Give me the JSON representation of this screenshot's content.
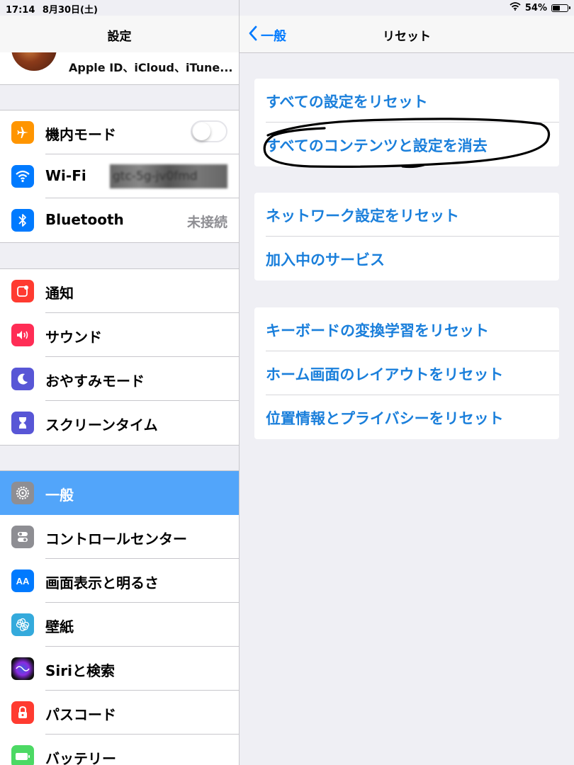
{
  "status_bar": {
    "time": "17:14",
    "date": "8月30日(土)",
    "battery": "54%",
    "battery_level": 0.54
  },
  "sidebar": {
    "title": "設定",
    "apple_id": "Apple ID、iCloud、iTune...",
    "groups": [
      [
        {
          "label": "機内モード",
          "icon": "airplane-icon",
          "color": "#ff9500",
          "toggle": false
        },
        {
          "label": "Wi-Fi",
          "icon": "wifi-icon",
          "color": "#007aff",
          "value": "gtc-5g-jv0fmd"
        },
        {
          "label": "Bluetooth",
          "icon": "bluetooth-icon",
          "color": "#007aff",
          "value": "未接続"
        }
      ],
      [
        {
          "label": "通知",
          "icon": "notifications-icon",
          "color": "#ff3b30"
        },
        {
          "label": "サウンド",
          "icon": "sound-icon",
          "color": "#ff2d55"
        },
        {
          "label": "おやすみモード",
          "icon": "moon-icon",
          "color": "#5856d6"
        },
        {
          "label": "スクリーンタイム",
          "icon": "hourglass-icon",
          "color": "#5856d6"
        }
      ],
      [
        {
          "label": "一般",
          "icon": "gear-icon",
          "color": "#8e8e93",
          "selected": true
        },
        {
          "label": "コントロールセンター",
          "icon": "control-center-icon",
          "color": "#8e8e93"
        },
        {
          "label": "画面表示と明るさ",
          "icon": "display-icon",
          "color": "#007aff"
        },
        {
          "label": "壁紙",
          "icon": "wallpaper-icon",
          "color": "#34aadc"
        },
        {
          "label": "Siriと検索",
          "icon": "siri-icon",
          "color": "#1c1c3a"
        },
        {
          "label": "パスコード",
          "icon": "lock-icon",
          "color": "#ff3b30"
        },
        {
          "label": "バッテリー",
          "icon": "battery-icon",
          "color": "#4cd964"
        }
      ]
    ]
  },
  "detail": {
    "back_label": "一般",
    "title": "リセット",
    "groups": [
      [
        "すべての設定をリセット",
        "すべてのコンテンツと設定を消去"
      ],
      [
        "ネットワーク設定をリセット",
        "加入中のサービス"
      ],
      [
        "キーボードの変換学習をリセット",
        "ホーム画面のレイアウトをリセット",
        "位置情報とプライバシーをリセット"
      ]
    ]
  }
}
